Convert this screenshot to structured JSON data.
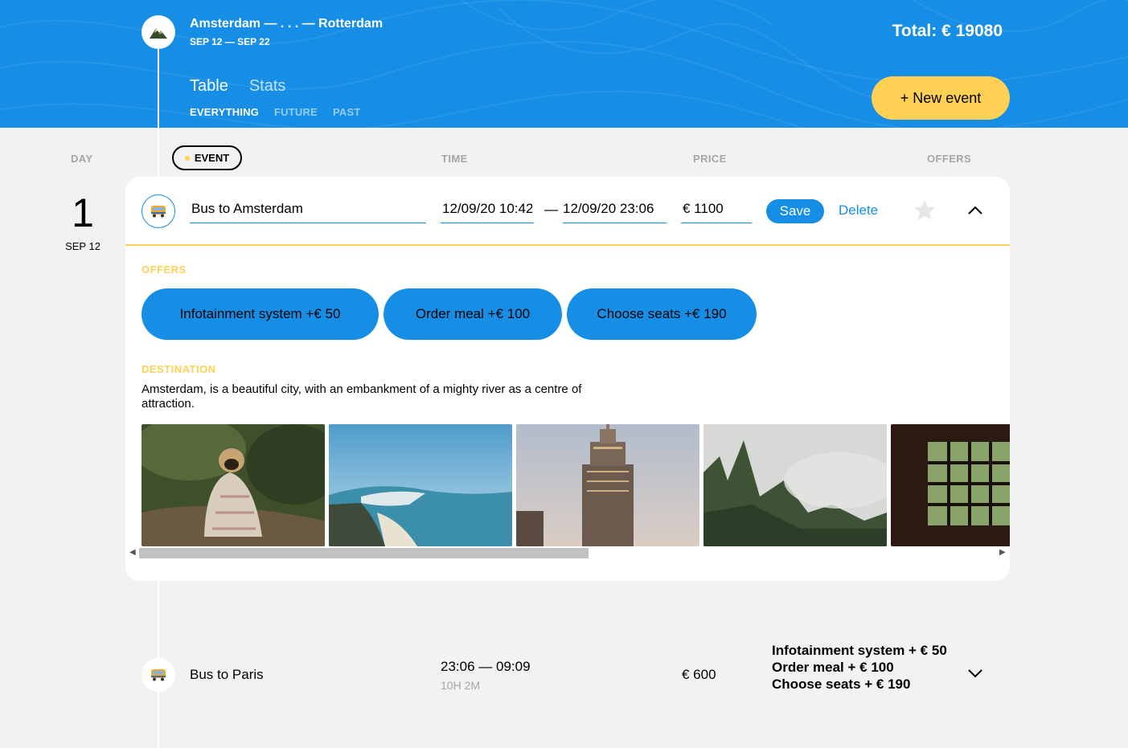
{
  "trip": {
    "route": "Amsterdam — . . . — Rotterdam",
    "dates": "SEP 12 — SEP 22",
    "total": "Total: € 19080"
  },
  "views": {
    "table": "Table",
    "stats": "Stats"
  },
  "filters": {
    "everything": "EVERYTHING",
    "future": "FUTURE",
    "past": "PAST",
    "active": "EVERYTHING"
  },
  "new_event_label": "+ New event",
  "columns": {
    "day": "DAY",
    "event": "EVENT",
    "time": "TIME",
    "price": "PRICE",
    "offers": "OFFERS"
  },
  "day": {
    "number": "1",
    "date": "SEP 12"
  },
  "edit_event": {
    "destination": "Bus to Amsterdam",
    "start": "12/09/20 10:42",
    "separator": "—",
    "end": "12/09/20 23:06",
    "price": "€ 1100",
    "save_label": "Save",
    "delete_label": "Delete",
    "favorite": false,
    "offers_title": "OFFERS",
    "offers": [
      {
        "label": "Infotainment system +€  50",
        "selected": true
      },
      {
        "label": "Order meal +€  100",
        "selected": true
      },
      {
        "label": "Choose seats +€  190",
        "selected": true
      }
    ],
    "destination_title": "DESTINATION",
    "destination_description": "Amsterdam, is a beautiful city, with an embankment of a mighty river as a centre of attraction.",
    "photos": [
      "pug-in-blanket",
      "coastal-beach",
      "skyscraper",
      "misty-forest",
      "barred-window"
    ]
  },
  "event_row": {
    "title": "Bus to Paris",
    "time": "23:06 — 09:09",
    "duration": "10H 2M",
    "price": "€ 600",
    "offers": [
      "Infotainment system + € 50",
      "Order meal + € 100",
      "Choose seats + € 190"
    ]
  },
  "colors": {
    "brand_blue": "#168ee6",
    "accent_yellow": "#ffd054",
    "background": "#f2f2f2",
    "muted_text": "#a6a6a6"
  }
}
